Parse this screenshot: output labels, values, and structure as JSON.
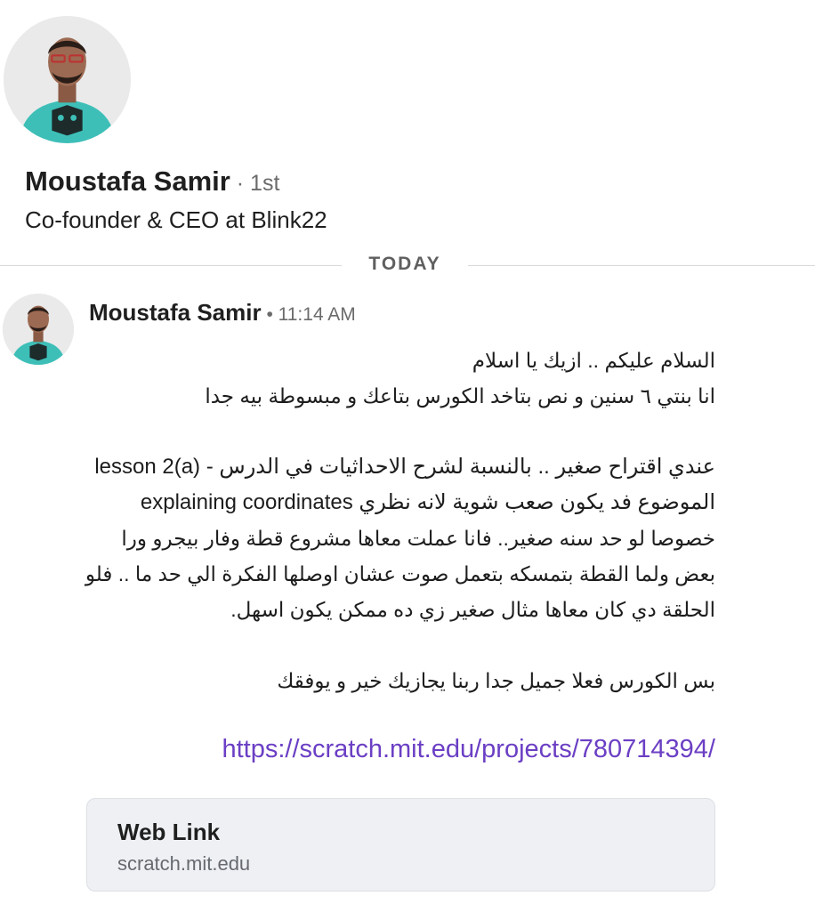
{
  "profile": {
    "name": "Moustafa Samir",
    "degree": " · 1st",
    "headline": "Co-founder & CEO at Blink22"
  },
  "divider": {
    "label": "TODAY"
  },
  "message": {
    "sender": "Moustafa Samir",
    "time": " • 11:14 AM",
    "lines": [
      "السلام عليكم .. ازيك يا اسلام",
      "انا بنتي ٦ سنين و نص بتاخد الكورس بتاعك و مبسوطة بيه جدا",
      "عندي اقتراح صغير .. بالنسبة لشرح الاحداثيات في الدرس  - lesson 2(a)",
      "explaining coordinates الموضوع فد يكون صعب شوية لانه نظري",
      "خصوصا لو حد سنه صغير.. فانا عملت معاها مشروع قطة وفار بيجرو ورا",
      "بعض ولما القطة بتمسكه بتعمل صوت عشان اوصلها الفكرة الي حد ما .. فلو",
      "الحلقة دي كان معاها مثال صغير زي ده ممكن يكون اسهل.",
      "بس الكورس فعلا جميل جدا ربنا يجازيك خير و يوفقك"
    ],
    "link": "https://scratch.mit.edu/projects/780714394/"
  },
  "link_card": {
    "title": "Web Link",
    "domain": "scratch.mit.edu"
  },
  "colors": {
    "link": "#6b3fc4",
    "shirt": "#3dbfb8",
    "card_bg": "#eef0f3"
  },
  "icons": {
    "profile_avatar": "person-photo",
    "message_avatar": "person-photo"
  }
}
